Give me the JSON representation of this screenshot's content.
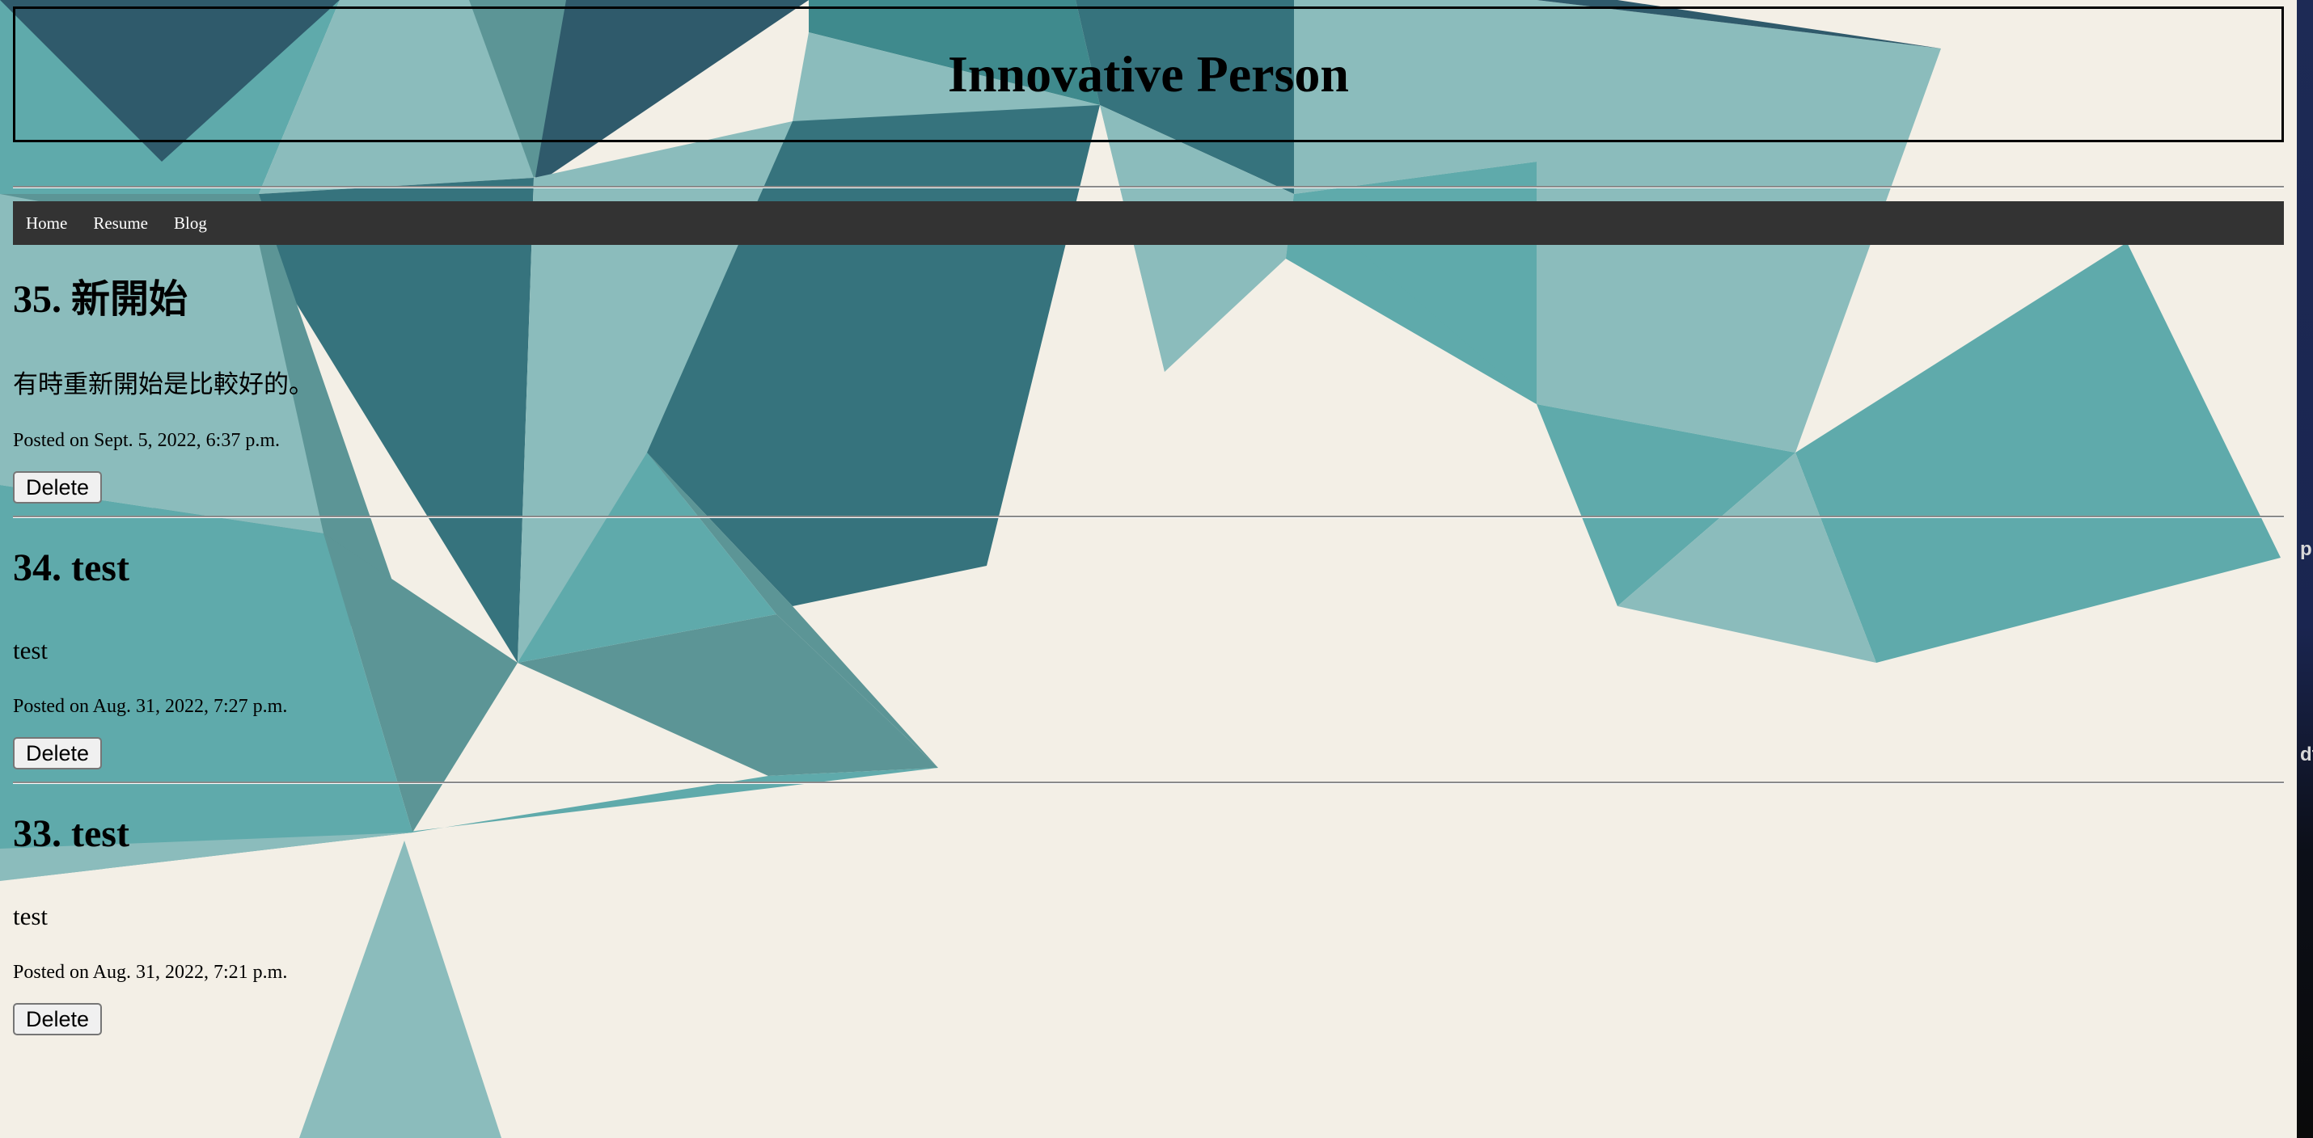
{
  "site": {
    "title": "Innovative Person"
  },
  "nav": {
    "items": [
      {
        "label": "Home"
      },
      {
        "label": "Resume"
      },
      {
        "label": "Blog"
      }
    ]
  },
  "posts": [
    {
      "heading": "35. 新開始",
      "body": "有時重新開始是比較好的。",
      "posted": "Posted on Sept. 5, 2022, 6:37 p.m.",
      "delete_label": "Delete"
    },
    {
      "heading": "34. test",
      "body": "test",
      "posted": "Posted on Aug. 31, 2022, 7:27 p.m.",
      "delete_label": "Delete"
    },
    {
      "heading": "33. test",
      "body": "test",
      "posted": "Posted on Aug. 31, 2022, 7:21 p.m.",
      "delete_label": "Delete"
    }
  ],
  "edge_fragments": {
    "upper": "p",
    "lower": "df"
  },
  "colors": {
    "page_background": "#f3efe6",
    "nav_background": "#333333",
    "teal_dark": "#2e5f6e",
    "teal_mid": "#5faaab",
    "teal_light": "#8bbcbc"
  },
  "icons": {
    "background": "teal-geometric-triangles-background"
  }
}
